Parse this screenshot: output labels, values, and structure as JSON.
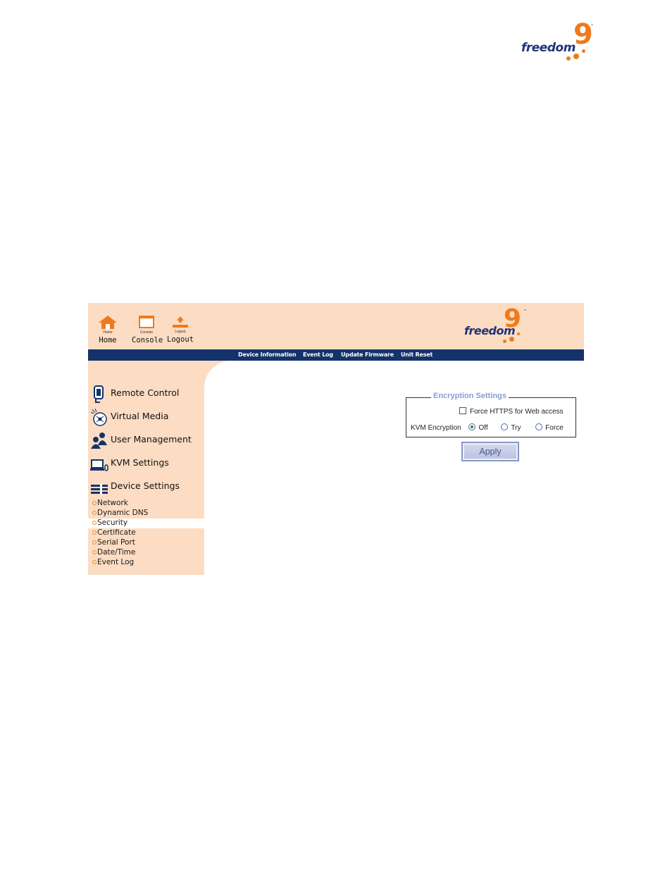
{
  "brand": {
    "word": "freedom",
    "nine": "9",
    "tm": "™"
  },
  "header": {
    "buttons": [
      {
        "icon": "home-icon",
        "tiny_label": "Home",
        "label": "Home"
      },
      {
        "icon": "console-icon",
        "tiny_label": "Console",
        "label": "Console"
      },
      {
        "icon": "logout-icon",
        "tiny_label": "Logout",
        "label": "Logout"
      }
    ]
  },
  "navbar": {
    "links": [
      "Device Information",
      "Event Log",
      "Update Firmware",
      "Unit Reset"
    ]
  },
  "sidebar": {
    "items": [
      {
        "icon": "remote-control-icon",
        "label": "Remote Control"
      },
      {
        "icon": "virtual-media-icon",
        "label": "Virtual Media"
      },
      {
        "icon": "user-management-icon",
        "label": "User Management"
      },
      {
        "icon": "kvm-settings-icon",
        "label": "KVM Settings"
      },
      {
        "icon": "device-settings-icon",
        "label": "Device Settings"
      }
    ],
    "subitems": [
      "Network",
      "Dynamic DNS",
      "Security",
      "Certificate",
      "Serial Port",
      "Date/Time",
      "Event Log"
    ],
    "active_subitem": "Security"
  },
  "encryption": {
    "legend": "Encryption Settings",
    "force_https_label": "Force HTTPS for Web access",
    "force_https_checked": false,
    "kvm_label": "KVM Encryption",
    "options": [
      "Off",
      "Try",
      "Force"
    ],
    "selected": "Off"
  },
  "apply_label": "Apply",
  "colors": {
    "peach": "#fcdcc3",
    "navy": "#14336a",
    "orange": "#f07a1a",
    "legend_blue": "#8a9dd4"
  }
}
